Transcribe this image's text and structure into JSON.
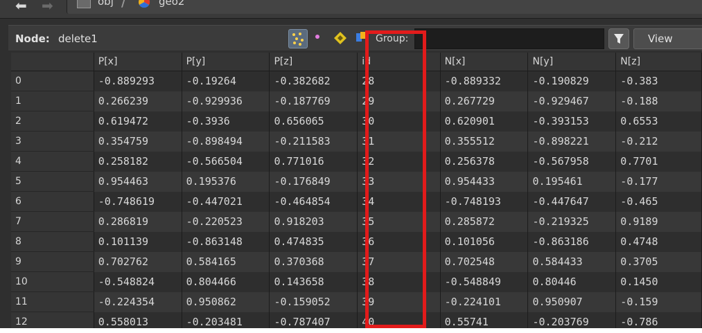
{
  "path": {
    "items": [
      {
        "label": "obj"
      },
      {
        "label": "geo2"
      }
    ]
  },
  "toolbar": {
    "node_label": "Node:",
    "node_value": "delete1",
    "group_label": "Group:",
    "group_value": "",
    "view_label": "View"
  },
  "table": {
    "headers": [
      "",
      "P[x]",
      "P[y]",
      "P[z]",
      "id",
      "N[x]",
      "N[y]",
      "N[z]"
    ],
    "rows": [
      [
        "0",
        "-0.889293",
        "-0.19264",
        "-0.382682",
        "28",
        "-0.889332",
        "-0.190829",
        "-0.383"
      ],
      [
        "1",
        "0.266239",
        "-0.929936",
        "-0.187769",
        "29",
        "0.267729",
        "-0.929467",
        "-0.188"
      ],
      [
        "2",
        "0.619472",
        "-0.3936",
        "0.656065",
        "30",
        "0.620901",
        "-0.393153",
        "0.6553"
      ],
      [
        "3",
        "0.354759",
        "-0.898494",
        "-0.211583",
        "31",
        "0.355512",
        "-0.898221",
        "-0.212"
      ],
      [
        "4",
        "0.258182",
        "-0.566504",
        "0.771016",
        "32",
        "0.256378",
        "-0.567958",
        "0.7701"
      ],
      [
        "5",
        "0.954463",
        "0.195376",
        "-0.176849",
        "33",
        "0.954433",
        "0.195461",
        "-0.177"
      ],
      [
        "6",
        "-0.748619",
        "-0.447021",
        "-0.464854",
        "34",
        "-0.748193",
        "-0.447647",
        "-0.465"
      ],
      [
        "7",
        "0.286819",
        "-0.220523",
        "0.918203",
        "35",
        "0.285872",
        "-0.219325",
        "0.9189"
      ],
      [
        "8",
        "0.101139",
        "-0.863148",
        "0.474835",
        "36",
        "0.101056",
        "-0.863186",
        "0.4748"
      ],
      [
        "9",
        "0.702762",
        "0.584165",
        "0.370368",
        "37",
        "0.702548",
        "0.584433",
        "0.3705"
      ],
      [
        "10",
        "-0.548824",
        "0.804466",
        "0.143658",
        "38",
        "-0.548849",
        "0.80446",
        "0.1450"
      ],
      [
        "11",
        "-0.224354",
        "0.950862",
        "-0.159052",
        "39",
        "-0.224101",
        "0.950907",
        "-0.159"
      ],
      [
        "12",
        "0.558013",
        "-0.203481",
        "-0.787407",
        "40",
        "0.55741",
        "-0.203769",
        "-0.786"
      ]
    ]
  },
  "icons": {
    "back": "arrow-left-icon",
    "forward": "arrow-right-icon",
    "obj": "network-obj-icon",
    "geo": "geo-node-icon",
    "points": "points-icon",
    "vertices": "vertices-icon",
    "primitives": "primitives-icon",
    "detail": "detail-icon",
    "filter": "filter-icon"
  },
  "colors": {
    "highlight": "#e21b1b",
    "background": "#2f2f2f"
  }
}
